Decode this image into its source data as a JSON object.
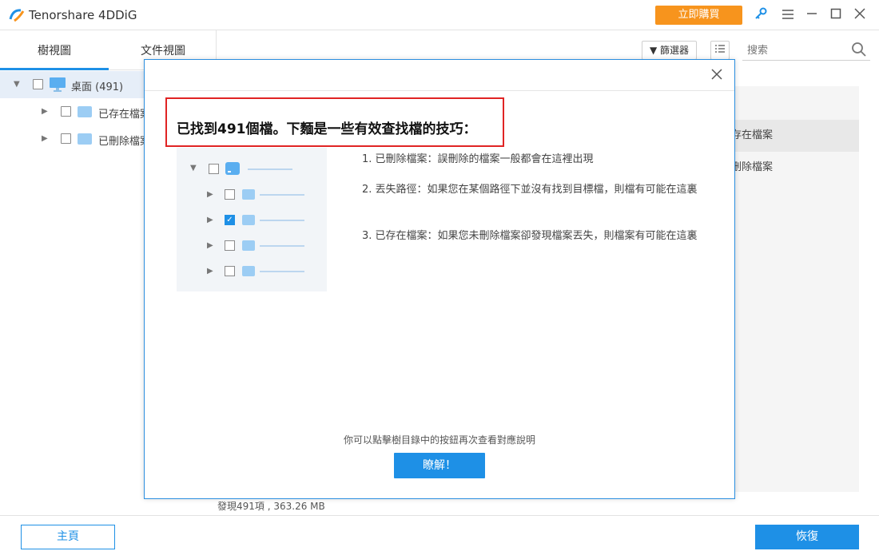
{
  "app": {
    "title": "Tenorshare 4DDiG",
    "buy_label": "立即購買"
  },
  "tabs": {
    "tree": "樹視圖",
    "file": "文件視圖"
  },
  "tree": {
    "root_label": "桌面 (491)",
    "items": [
      {
        "label": "已存在檔案"
      },
      {
        "label": "已刪除檔案"
      }
    ]
  },
  "toolbar": {
    "filter_label": "篩選器",
    "search_placeholder": "搜索"
  },
  "list": {
    "rows": [
      "存在檔案",
      "刪除檔案"
    ]
  },
  "status": {
    "found": "發現491項 , 363.26 MB"
  },
  "bottom": {
    "home_label": "主頁",
    "recover_label": "恢復"
  },
  "modal": {
    "heading": "已找到491個檔。下麵是一些有效查找檔的技巧：",
    "tips": [
      "1. 已刪除檔案：誤刪除的檔案一般都會在這裡出現",
      "2. 丟失路徑：如果您在某個路徑下並沒有找到目標檔，則檔有可能在這裏",
      "3. 已存在檔案：如果您未刪除檔案卻發現檔案丟失，則檔案有可能在這裏"
    ],
    "note": "你可以點擊樹目錄中的按鈕再次查看對應說明",
    "ok_label": "瞭解！"
  },
  "colors": {
    "accent": "#1e90e6",
    "buy": "#f7941d",
    "highlight": "#e02424"
  }
}
